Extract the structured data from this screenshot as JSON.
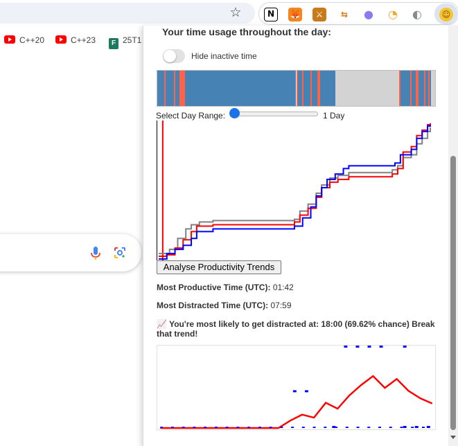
{
  "browser": {
    "bookmarks": [
      {
        "label": "C++20",
        "icon": "youtube-icon"
      },
      {
        "label": "C++23",
        "icon": "youtube-icon"
      },
      {
        "label": "25T1",
        "icon": "forms-icon"
      }
    ],
    "extensions": [
      "notion-icon",
      "metamask-icon",
      "sword-icon",
      "git-icon",
      "ghost-icon",
      "timer-icon",
      "puzzle-icon",
      "face-icon"
    ]
  },
  "popup": {
    "heading": "Your time usage throughout the day:",
    "toggle_label": "Hide inactive time",
    "toggle_on": false,
    "range_label": "Select Day Range:",
    "range_value_label": "1 Day",
    "range_fraction": 0.0,
    "analyse_button": "Analyse Productivity Trends",
    "most_productive_label": "Most Productive Time (UTC):",
    "most_productive_value": "01:42",
    "most_distracted_label": "Most Distracted Time (UTC):",
    "most_distracted_value": "07:59",
    "insight_emoji": "📈",
    "insight_text": "You're most likely to get distracted at: 18:00 (69.62% chance) Break that trend!"
  },
  "colors": {
    "productive": "#4682b4",
    "distracted": "#ff6347",
    "inactive": "#d3d3d3",
    "line_blue": "#0000ff",
    "line_red": "#ff0000",
    "line_gray": "#808080",
    "accent": "#1a73e8"
  },
  "timeline": [
    {
      "s": 0,
      "e": 0.025,
      "c": "productive"
    },
    {
      "s": 0.025,
      "e": 0.03,
      "c": "distracted"
    },
    {
      "s": 0.03,
      "e": 0.06,
      "c": "productive"
    },
    {
      "s": 0.06,
      "e": 0.065,
      "c": "distracted"
    },
    {
      "s": 0.065,
      "e": 0.08,
      "c": "productive"
    },
    {
      "s": 0.08,
      "e": 0.1,
      "c": "distracted"
    },
    {
      "s": 0.1,
      "e": 0.5,
      "c": "productive"
    },
    {
      "s": 0.5,
      "e": 0.505,
      "c": "distracted"
    },
    {
      "s": 0.505,
      "e": 0.52,
      "c": "productive"
    },
    {
      "s": 0.52,
      "e": 0.527,
      "c": "distracted"
    },
    {
      "s": 0.527,
      "e": 0.55,
      "c": "productive"
    },
    {
      "s": 0.55,
      "e": 0.555,
      "c": "distracted"
    },
    {
      "s": 0.555,
      "e": 0.575,
      "c": "productive"
    },
    {
      "s": 0.575,
      "e": 0.585,
      "c": "distracted"
    },
    {
      "s": 0.585,
      "e": 0.64,
      "c": "productive"
    },
    {
      "s": 0.64,
      "e": 0.87,
      "c": "inactive"
    },
    {
      "s": 0.87,
      "e": 0.875,
      "c": "distracted"
    },
    {
      "s": 0.875,
      "e": 0.91,
      "c": "productive"
    },
    {
      "s": 0.91,
      "e": 0.915,
      "c": "distracted"
    },
    {
      "s": 0.915,
      "e": 0.93,
      "c": "productive"
    },
    {
      "s": 0.93,
      "e": 0.94,
      "c": "distracted"
    },
    {
      "s": 0.94,
      "e": 0.96,
      "c": "productive"
    },
    {
      "s": 0.96,
      "e": 0.965,
      "c": "distracted"
    },
    {
      "s": 0.965,
      "e": 0.975,
      "c": "productive"
    },
    {
      "s": 0.975,
      "e": 0.98,
      "c": "distracted"
    },
    {
      "s": 0.98,
      "e": 0.985,
      "c": "productive"
    },
    {
      "s": 0.985,
      "e": 1.0,
      "c": "inactive"
    }
  ],
  "chart_data": [
    {
      "type": "line",
      "title": "",
      "xlabel": "",
      "ylabel": "",
      "xlim": [
        0,
        1
      ],
      "ylim": [
        0,
        1
      ],
      "series": [
        {
          "color": "#0000ff",
          "points": [
            [
              0,
              0.0
            ],
            [
              0.02,
              0.0
            ],
            [
              0.03,
              0.04
            ],
            [
              0.06,
              0.07
            ],
            [
              0.09,
              0.1
            ],
            [
              0.12,
              0.15
            ],
            [
              0.14,
              0.2
            ],
            [
              0.2,
              0.22
            ],
            [
              0.5,
              0.24
            ],
            [
              0.53,
              0.3
            ],
            [
              0.56,
              0.38
            ],
            [
              0.58,
              0.46
            ],
            [
              0.6,
              0.52
            ],
            [
              0.62,
              0.58
            ],
            [
              0.65,
              0.62
            ],
            [
              0.68,
              0.66
            ],
            [
              0.7,
              0.68
            ],
            [
              0.87,
              0.7
            ],
            [
              0.89,
              0.76
            ],
            [
              0.93,
              0.8
            ],
            [
              0.95,
              0.88
            ],
            [
              0.97,
              0.93
            ],
            [
              0.99,
              0.97
            ],
            [
              1.0,
              0.98
            ]
          ]
        },
        {
          "color": "#ff0000",
          "points": [
            [
              0,
              0.02
            ],
            [
              0.03,
              0.03
            ],
            [
              0.06,
              0.08
            ],
            [
              0.09,
              0.14
            ],
            [
              0.12,
              0.2
            ],
            [
              0.14,
              0.24
            ],
            [
              0.2,
              0.25
            ],
            [
              0.5,
              0.27
            ],
            [
              0.52,
              0.32
            ],
            [
              0.55,
              0.37
            ],
            [
              0.58,
              0.45
            ],
            [
              0.6,
              0.52
            ],
            [
              0.63,
              0.56
            ],
            [
              0.66,
              0.58
            ],
            [
              0.7,
              0.6
            ],
            [
              0.86,
              0.62
            ],
            [
              0.88,
              0.66
            ],
            [
              0.9,
              0.78
            ],
            [
              0.93,
              0.82
            ],
            [
              0.95,
              0.9
            ],
            [
              0.97,
              0.94
            ],
            [
              0.99,
              0.98
            ],
            [
              1.0,
              0.99
            ]
          ]
        },
        {
          "color": "#808080",
          "points": [
            [
              0,
              0.04
            ],
            [
              0.04,
              0.07
            ],
            [
              0.07,
              0.15
            ],
            [
              0.1,
              0.22
            ],
            [
              0.12,
              0.25
            ],
            [
              0.15,
              0.27
            ],
            [
              0.2,
              0.28
            ],
            [
              0.5,
              0.29
            ],
            [
              0.52,
              0.35
            ],
            [
              0.55,
              0.4
            ],
            [
              0.58,
              0.48
            ],
            [
              0.6,
              0.54
            ],
            [
              0.63,
              0.59
            ],
            [
              0.66,
              0.61
            ],
            [
              0.7,
              0.63
            ],
            [
              0.86,
              0.65
            ],
            [
              0.88,
              0.68
            ],
            [
              0.9,
              0.74
            ],
            [
              0.93,
              0.76
            ],
            [
              0.95,
              0.84
            ],
            [
              0.97,
              0.88
            ],
            [
              0.99,
              0.93
            ],
            [
              1.0,
              0.96
            ]
          ]
        }
      ],
      "spike": {
        "x": 0.015,
        "color": "#ff0000"
      }
    },
    {
      "type": "line",
      "title": "",
      "xlabel": "",
      "ylabel": "",
      "x": [
        0,
        1,
        2,
        3,
        4,
        5,
        6,
        7,
        8,
        9,
        10,
        11,
        12,
        13,
        14,
        15,
        16,
        17,
        18,
        19,
        20,
        21,
        22,
        23
      ],
      "ylim": [
        0,
        1
      ],
      "series": [
        {
          "color": "#ff0000",
          "values": [
            0,
            0,
            0,
            0,
            0,
            0,
            0,
            0,
            0,
            0,
            0,
            0.1,
            0.18,
            0.14,
            0.34,
            0.26,
            0.44,
            0.58,
            0.7,
            0.54,
            0.66,
            0.5,
            0.4,
            0.33
          ]
        },
        {
          "color": "#0000ff",
          "style": "dotted",
          "values": [
            null,
            null,
            null,
            null,
            null,
            null,
            null,
            null,
            null,
            null,
            null,
            0.5,
            0.5,
            null,
            null,
            null,
            null,
            null,
            null,
            null,
            null,
            null,
            null,
            null
          ],
          "edge_marks_top": [
            16,
            17,
            18,
            19,
            21
          ],
          "edge_marks_bottom": [
            15,
            21,
            22,
            23
          ]
        }
      ]
    }
  ]
}
